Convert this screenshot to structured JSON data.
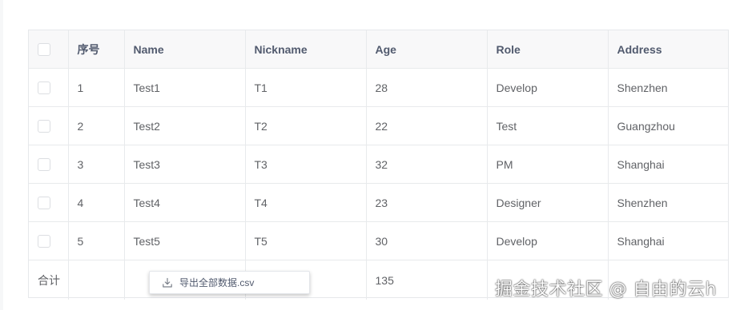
{
  "table": {
    "columns": [
      "序号",
      "Name",
      "Nickname",
      "Age",
      "Role",
      "Address"
    ],
    "rows": [
      {
        "index": "1",
        "name": "Test1",
        "nickname": "T1",
        "age": "28",
        "role": "Develop",
        "address": "Shenzhen"
      },
      {
        "index": "2",
        "name": "Test2",
        "nickname": "T2",
        "age": "22",
        "role": "Test",
        "address": "Guangzhou"
      },
      {
        "index": "3",
        "name": "Test3",
        "nickname": "T3",
        "age": "32",
        "role": "PM",
        "address": "Shanghai"
      },
      {
        "index": "4",
        "name": "Test4",
        "nickname": "T4",
        "age": "23",
        "role": "Designer",
        "address": "Shenzhen"
      },
      {
        "index": "5",
        "name": "Test5",
        "nickname": "T5",
        "age": "30",
        "role": "Develop",
        "address": "Shanghai"
      }
    ],
    "footer": {
      "label": "合计",
      "age_total": "135"
    }
  },
  "context_menu": {
    "export_label": "导出全部数据.csv",
    "icon": "download-icon"
  },
  "watermark": "掘金技术社区 @ 自由的云h",
  "colors": {
    "header_bg": "#f8f8f9",
    "border": "#e8eaec",
    "text": "#606266",
    "header_text": "#515a6e"
  }
}
